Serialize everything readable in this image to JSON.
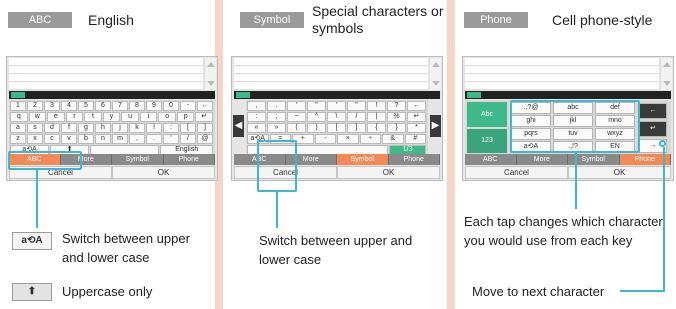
{
  "panel_english": {
    "mode_badge": "ABC",
    "mode_title": "English",
    "keys_row1": [
      "1",
      "2",
      "3",
      "4",
      "5",
      "6",
      "7",
      "8",
      "9",
      "0",
      "-",
      "←"
    ],
    "keys_row2": [
      "q",
      "w",
      "e",
      "r",
      "t",
      "y",
      "u",
      "i",
      "o",
      "p",
      "↵"
    ],
    "keys_row3": [
      "a",
      "s",
      "d",
      "f",
      "g",
      "h",
      "j",
      "k",
      "l",
      ":",
      "[",
      "]"
    ],
    "keys_row4": [
      "z",
      "x",
      "c",
      "v",
      "b",
      "n",
      "m",
      ",",
      ".",
      "'",
      "/",
      "@"
    ],
    "shift_key": "a⟲A",
    "uppercase_key": "⬆",
    "lang_button": "English",
    "tabs": [
      "ABC",
      "More",
      "Symbol",
      "Phone"
    ],
    "cancel": "Cancel",
    "ok": "OK",
    "legend_switch_icon": "a⟲A",
    "legend_switch_text": "Switch between upper and lower case",
    "legend_upper_icon": "⬆",
    "legend_upper_text": "Uppercase only"
  },
  "panel_symbol": {
    "mode_badge": "Symbol",
    "mode_title": "Special characters or symbols",
    "keys_row1": [
      ",",
      ".",
      "'",
      "\"",
      "'",
      "\"",
      "!",
      "?",
      "←"
    ],
    "keys_row2": [
      ":",
      ";",
      "~",
      "^",
      "\\",
      "/",
      "|",
      "%",
      "↵"
    ],
    "keys_row3": [
      "«",
      "»",
      "(",
      ")",
      "[",
      "]",
      "{",
      "}",
      "*"
    ],
    "keys_row4": [
      "a⟲A",
      "=",
      "+",
      "-",
      "×",
      "÷",
      "&",
      "#"
    ],
    "page_indicator": "1/3",
    "tabs": [
      "ABC",
      "More",
      "Symbol",
      "Phone"
    ],
    "cancel": "Cancel",
    "ok": "OK",
    "desc": "Switch between upper and lower case"
  },
  "panel_phone": {
    "mode_badge": "Phone",
    "mode_title": "Cell phone-style",
    "side_top": "Abc",
    "side_bottom": "123",
    "cells": [
      ".,?@",
      "abc",
      "def",
      "ghi",
      "jkl",
      "mno",
      "pqrs",
      "tuv",
      "wxyz",
      "a⟲A",
      ".,!?",
      "EN"
    ],
    "backspace": "←",
    "enter": "↵",
    "next": "→",
    "tabs": [
      "ABC",
      "More",
      "Symbol",
      "Phone"
    ],
    "cancel": "Cancel",
    "ok": "OK",
    "desc_tap": "Each tap changes which character you would use from each key",
    "desc_next": "Move to next character"
  }
}
